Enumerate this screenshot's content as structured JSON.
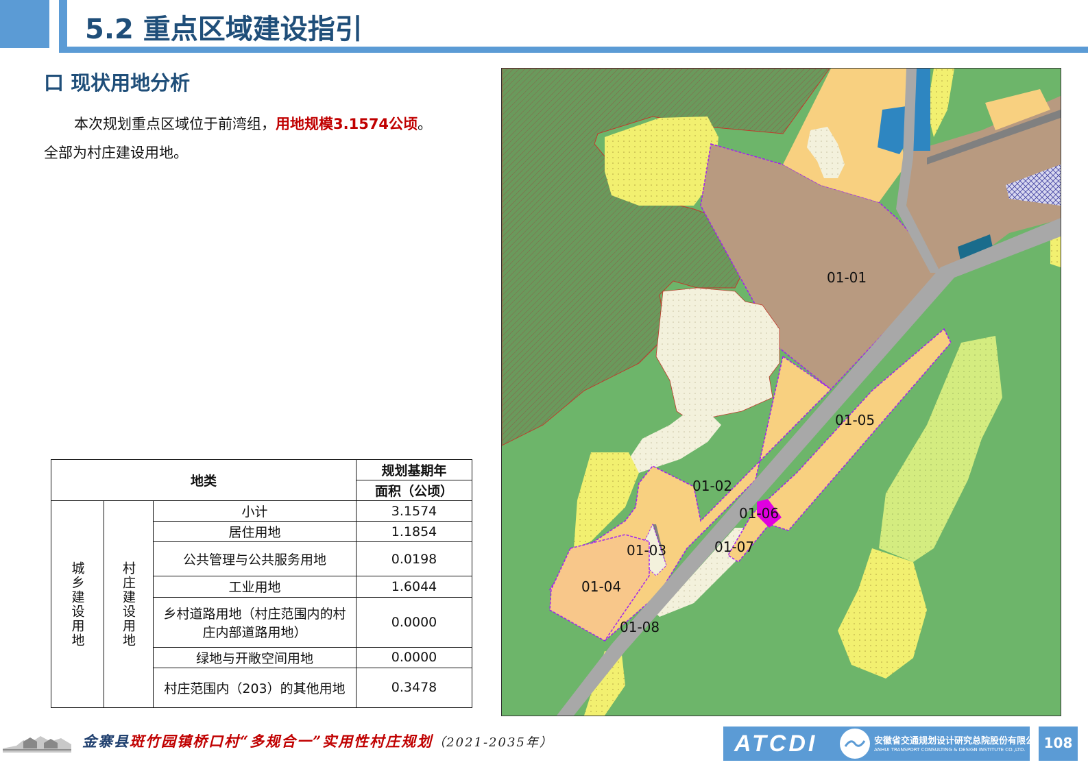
{
  "header": {
    "title": "5.2 重点区域建设指引"
  },
  "section": {
    "title": "口 现状用地分析"
  },
  "paragraph": {
    "text_before": "本次规划重点区域位于前湾组，",
    "emphasis": "用地规模3.1574公顷",
    "text_after": "。全部为村庄建设用地。"
  },
  "table": {
    "header_category": "地类",
    "header_year": "规划基期年",
    "header_area": "面积（公顷）",
    "group_level1": "城乡建设用地",
    "group_level2": "村庄建设用地",
    "rows": [
      {
        "name": "小计",
        "value": "3.1574"
      },
      {
        "name": "居住用地",
        "value": "1.1854"
      },
      {
        "name": "公共管理与公共服务用地",
        "value": "0.0198"
      },
      {
        "name": "工业用地",
        "value": "1.6044"
      },
      {
        "name": "乡村道路用地（村庄范围内的村庄内部道路用地）",
        "value": "0.0000"
      },
      {
        "name": "绿地与开敞空间用地",
        "value": "0.0000"
      },
      {
        "name": "村庄范围内（203）的其他用地",
        "value": "0.3478"
      }
    ]
  },
  "map": {
    "plot_labels": [
      "01-01",
      "01-02",
      "01-03",
      "01-04",
      "01-05",
      "01-06",
      "01-07",
      "01-08"
    ],
    "colors": {
      "forest": "#6a9a5c",
      "green": "#6db56a",
      "industrial": "#b89a80",
      "residential": "#f8d080",
      "yellow": "#f2f070",
      "other": "#f3f1dc",
      "road": "#a8a8a8",
      "water": "#2e86c1",
      "boundary": "#a020f0",
      "public": "#e000e0"
    }
  },
  "footer": {
    "title_prefix": "金寨县",
    "title_red": "斑竹园镇桥口村“多规合一”实用性村庄规划",
    "title_years": "（2021-2035年）",
    "logo_text": "ATCDI",
    "company_cn": "安徽省交通规划设计研究总院股份有限公司",
    "company_en": "ANHUI TRANSPORT CONSULTING & DESIGN INSTITUTE CO.,LTD.",
    "page_number": "108"
  }
}
